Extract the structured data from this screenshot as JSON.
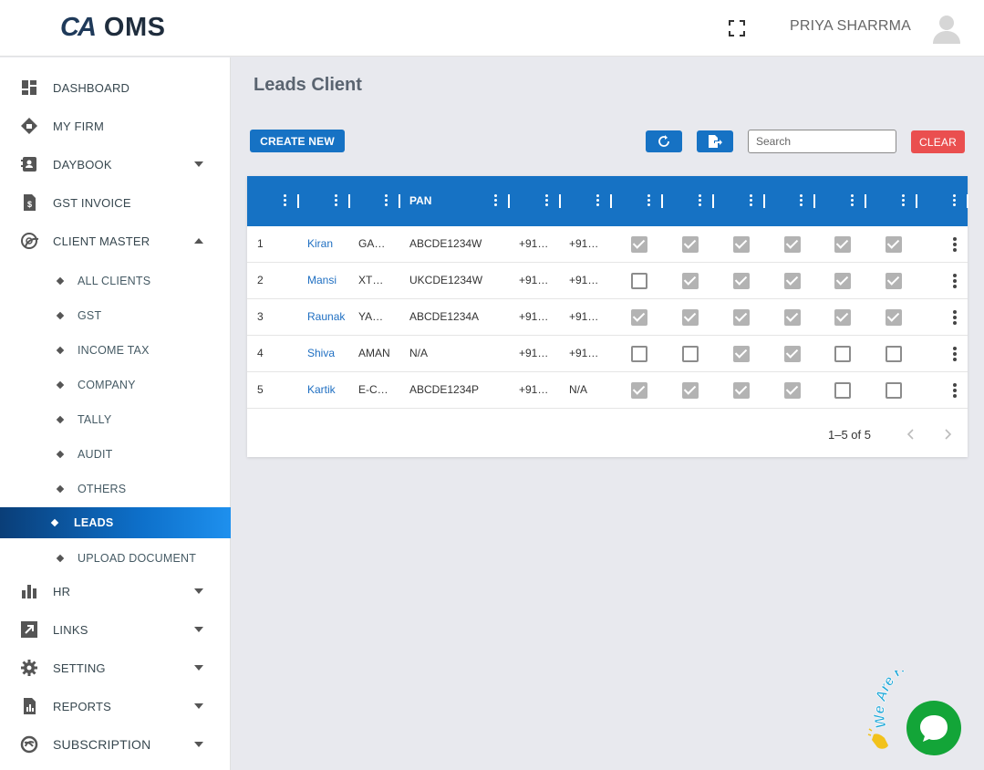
{
  "header": {
    "logo_mark": "CA",
    "logo_name": "OMS",
    "user_name": "PRIYA SHARRMA"
  },
  "sidebar": {
    "items": [
      {
        "label": "DASHBOARD",
        "icon": "dashboard-icon"
      },
      {
        "label": "MY FIRM",
        "icon": "firm-icon"
      },
      {
        "label": "DAYBOOK",
        "icon": "daybook-icon",
        "caret": "down"
      },
      {
        "label": "GST INVOICE",
        "icon": "invoice-icon"
      },
      {
        "label": "CLIENT MASTER",
        "icon": "client-master-icon",
        "caret": "up"
      }
    ],
    "sub_items": [
      {
        "label": "ALL CLIENTS"
      },
      {
        "label": "GST"
      },
      {
        "label": "INCOME TAX"
      },
      {
        "label": "COMPANY"
      },
      {
        "label": "TALLY"
      },
      {
        "label": "AUDIT"
      },
      {
        "label": "OTHERS"
      },
      {
        "label": "LEADS",
        "active": true
      },
      {
        "label": "UPLOAD DOCUMENT"
      }
    ],
    "bottom_items": [
      {
        "label": "HR",
        "icon": "bar-chart-icon"
      },
      {
        "label": "LINKS",
        "icon": "link-arrow-icon"
      },
      {
        "label": "SETTING",
        "icon": "gear-icon"
      },
      {
        "label": "REPORTS",
        "icon": "report-icon"
      },
      {
        "label": "SUBSCRIPTION",
        "icon": "subscription-icon"
      }
    ]
  },
  "main": {
    "title": "Leads Client",
    "create_label": "CREATE NEW",
    "search_placeholder": "Search",
    "clear_label": "CLEAR",
    "table": {
      "header_pan": "PAN",
      "rows": [
        {
          "no": "1",
          "name": "Kiran",
          "c3": "GA…",
          "pan": "ABCDE1234W",
          "p1": "+91…",
          "p2": "+91…",
          "checks": [
            true,
            true,
            true,
            true,
            true,
            true
          ]
        },
        {
          "no": "2",
          "name": "Mansi",
          "c3": "XT…",
          "pan": "UKCDE1234W",
          "p1": "+91…",
          "p2": "+91…",
          "checks": [
            false,
            true,
            true,
            true,
            true,
            true
          ]
        },
        {
          "no": "3",
          "name": "Raunak",
          "c3": "YA…",
          "pan": "ABCDE1234A",
          "p1": "+91…",
          "p2": "+91…",
          "checks": [
            true,
            true,
            true,
            true,
            true,
            true
          ]
        },
        {
          "no": "4",
          "name": "Shiva",
          "c3": "AMAN",
          "pan": "N/A",
          "p1": "+91…",
          "p2": "+91…",
          "checks": [
            false,
            false,
            true,
            true,
            false,
            false
          ]
        },
        {
          "no": "5",
          "name": "Kartik",
          "c3": "E-C…",
          "pan": "ABCDE1234P",
          "p1": "+91…",
          "p2": "N/A",
          "checks": [
            true,
            true,
            true,
            true,
            false,
            false
          ]
        }
      ]
    },
    "pager": {
      "range": "1–5 of 5"
    }
  },
  "chat": {
    "banner": "We Are Here!",
    "colors": {
      "bubble": "#13a538",
      "banner": "#1ea7d8"
    }
  }
}
